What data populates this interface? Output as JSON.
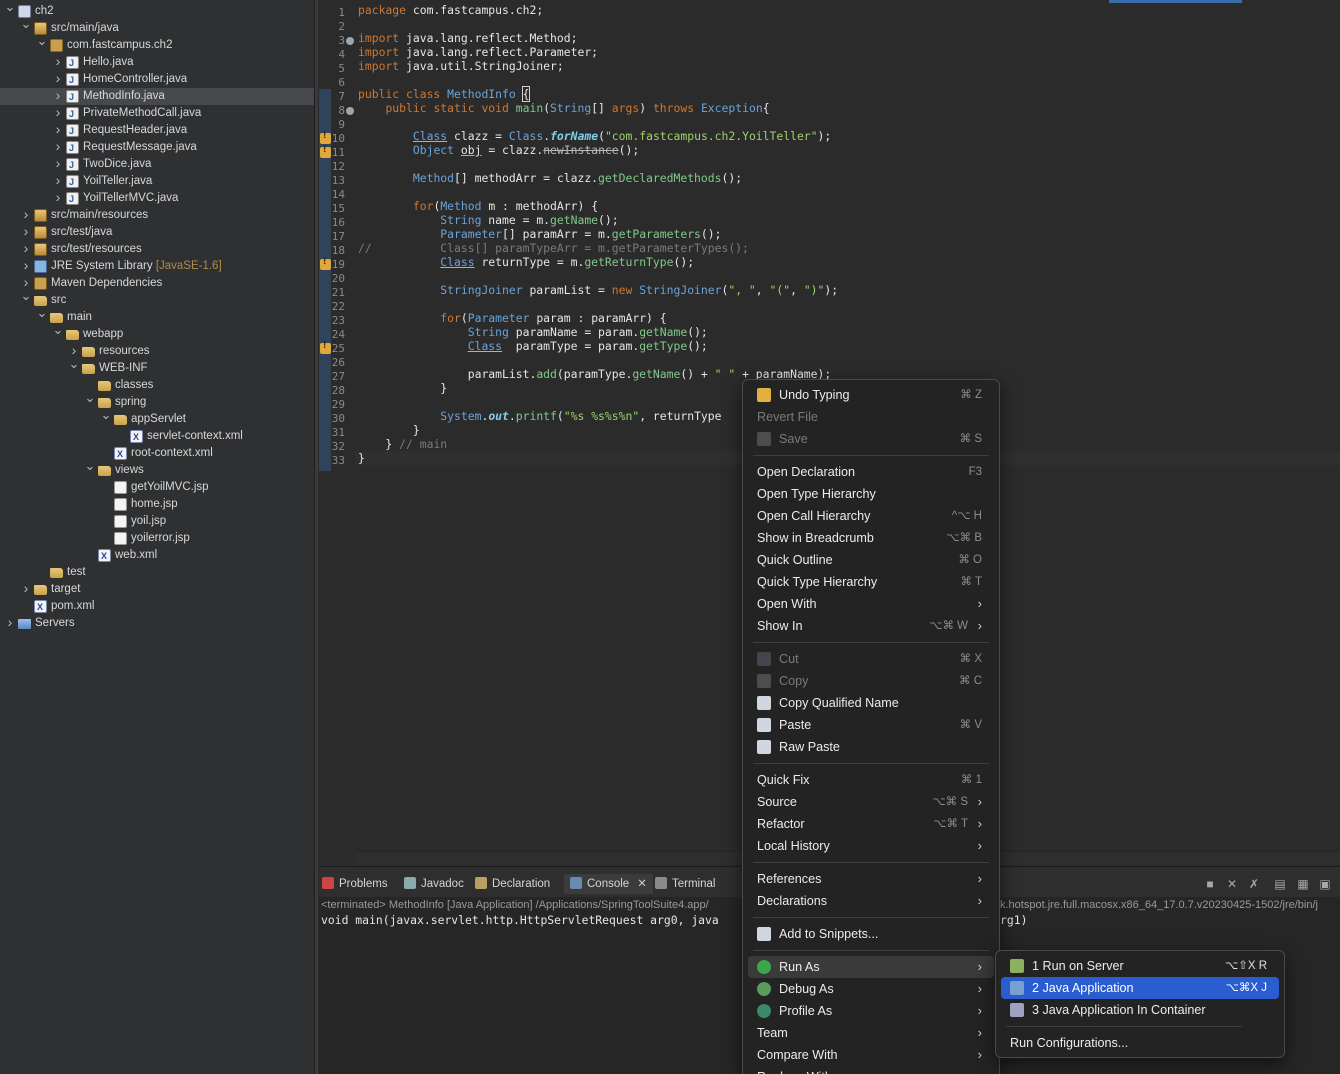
{
  "tree": {
    "items": [
      {
        "label": "ch2",
        "deco": "",
        "depth": 0,
        "twisty": "v",
        "icon": "project-icon",
        "ic": "proj",
        "selected": false
      },
      {
        "label": "src/main/java",
        "deco": "",
        "depth": 1,
        "twisty": "v",
        "icon": "source-folder-icon",
        "ic": "pkgroot",
        "selected": false
      },
      {
        "label": "com.fastcampus.ch2",
        "deco": "",
        "depth": 2,
        "twisty": "v",
        "icon": "package-icon",
        "ic": "pkg",
        "selected": false
      },
      {
        "label": "Hello.java",
        "deco": "",
        "depth": 3,
        "twisty": ">",
        "icon": "java-file-icon",
        "ic": "java",
        "selected": false
      },
      {
        "label": "HomeController.java",
        "deco": "",
        "depth": 3,
        "twisty": ">",
        "icon": "java-file-icon",
        "ic": "java",
        "selected": false
      },
      {
        "label": "MethodInfo.java",
        "deco": "",
        "depth": 3,
        "twisty": ">",
        "icon": "java-file-icon",
        "ic": "java",
        "selected": true
      },
      {
        "label": "PrivateMethodCall.java",
        "deco": "",
        "depth": 3,
        "twisty": ">",
        "icon": "java-file-icon",
        "ic": "java",
        "selected": false
      },
      {
        "label": "RequestHeader.java",
        "deco": "",
        "depth": 3,
        "twisty": ">",
        "icon": "java-file-icon",
        "ic": "java",
        "selected": false
      },
      {
        "label": "RequestMessage.java",
        "deco": "",
        "depth": 3,
        "twisty": ">",
        "icon": "java-file-icon",
        "ic": "java",
        "selected": false
      },
      {
        "label": "TwoDice.java",
        "deco": "",
        "depth": 3,
        "twisty": ">",
        "icon": "java-file-icon",
        "ic": "java",
        "selected": false
      },
      {
        "label": "YoilTeller.java",
        "deco": "",
        "depth": 3,
        "twisty": ">",
        "icon": "java-file-icon",
        "ic": "java",
        "selected": false
      },
      {
        "label": "YoilTellerMVC.java",
        "deco": "",
        "depth": 3,
        "twisty": ">",
        "icon": "java-file-icon",
        "ic": "java",
        "selected": false
      },
      {
        "label": "src/main/resources",
        "deco": "",
        "depth": 1,
        "twisty": ">",
        "icon": "source-folder-icon",
        "ic": "pkgroot",
        "selected": false
      },
      {
        "label": "src/test/java",
        "deco": "",
        "depth": 1,
        "twisty": ">",
        "icon": "source-folder-icon",
        "ic": "pkgroot",
        "selected": false
      },
      {
        "label": "src/test/resources",
        "deco": "",
        "depth": 1,
        "twisty": ">",
        "icon": "source-folder-icon",
        "ic": "pkgroot",
        "selected": false
      },
      {
        "label": "JRE System Library ",
        "deco": "[JavaSE-1.6]",
        "depth": 1,
        "twisty": ">",
        "icon": "library-icon",
        "ic": "lib",
        "selected": false
      },
      {
        "label": "Maven Dependencies",
        "deco": "",
        "depth": 1,
        "twisty": ">",
        "icon": "maven-library-icon",
        "ic": "mvn",
        "selected": false
      },
      {
        "label": "src",
        "deco": "",
        "depth": 1,
        "twisty": "v",
        "icon": "folder-icon",
        "ic": "folder",
        "selected": false
      },
      {
        "label": "main",
        "deco": "",
        "depth": 2,
        "twisty": "v",
        "icon": "folder-icon",
        "ic": "folder",
        "selected": false
      },
      {
        "label": "webapp",
        "deco": "",
        "depth": 3,
        "twisty": "v",
        "icon": "folder-icon",
        "ic": "folder",
        "selected": false
      },
      {
        "label": "resources",
        "deco": "",
        "depth": 4,
        "twisty": ">",
        "icon": "folder-icon",
        "ic": "folder",
        "selected": false
      },
      {
        "label": "WEB-INF",
        "deco": "",
        "depth": 4,
        "twisty": "v",
        "icon": "folder-icon",
        "ic": "folder",
        "selected": false
      },
      {
        "label": "classes",
        "deco": "",
        "depth": 5,
        "twisty": "",
        "icon": "folder-icon",
        "ic": "folder",
        "selected": false
      },
      {
        "label": "spring",
        "deco": "",
        "depth": 5,
        "twisty": "v",
        "icon": "folder-icon",
        "ic": "folder",
        "selected": false
      },
      {
        "label": "appServlet",
        "deco": "",
        "depth": 6,
        "twisty": "v",
        "icon": "folder-icon",
        "ic": "folder",
        "selected": false
      },
      {
        "label": "servlet-context.xml",
        "deco": "",
        "depth": 7,
        "twisty": "",
        "icon": "xml-file-icon",
        "ic": "xml",
        "selected": false
      },
      {
        "label": "root-context.xml",
        "deco": "",
        "depth": 6,
        "twisty": "",
        "icon": "xml-file-icon",
        "ic": "xml",
        "selected": false
      },
      {
        "label": "views",
        "deco": "",
        "depth": 5,
        "twisty": "v",
        "icon": "folder-icon",
        "ic": "folder",
        "selected": false
      },
      {
        "label": "getYoilMVC.jsp",
        "deco": "",
        "depth": 6,
        "twisty": "",
        "icon": "jsp-file-icon",
        "ic": "jsp",
        "selected": false
      },
      {
        "label": "home.jsp",
        "deco": "",
        "depth": 6,
        "twisty": "",
        "icon": "jsp-file-icon",
        "ic": "jsp",
        "selected": false
      },
      {
        "label": "yoil.jsp",
        "deco": "",
        "depth": 6,
        "twisty": "",
        "icon": "jsp-file-icon",
        "ic": "jsp",
        "selected": false
      },
      {
        "label": "yoilerror.jsp",
        "deco": "",
        "depth": 6,
        "twisty": "",
        "icon": "jsp-file-icon",
        "ic": "jsp",
        "selected": false
      },
      {
        "label": "web.xml",
        "deco": "",
        "depth": 5,
        "twisty": "",
        "icon": "xml-file-icon",
        "ic": "xml",
        "selected": false
      },
      {
        "label": "test",
        "deco": "",
        "depth": 2,
        "twisty": "",
        "icon": "folder-icon",
        "ic": "folder",
        "selected": false
      },
      {
        "label": "target",
        "deco": "",
        "depth": 1,
        "twisty": ">",
        "icon": "folder-icon",
        "ic": "folder",
        "selected": false
      },
      {
        "label": "pom.xml",
        "deco": "",
        "depth": 1,
        "twisty": "",
        "icon": "maven-pom-icon",
        "ic": "xml",
        "selected": false
      },
      {
        "label": "Servers",
        "deco": "",
        "depth": 0,
        "twisty": ">",
        "icon": "servers-folder-icon",
        "ic": "srv",
        "selected": false
      }
    ]
  },
  "editor": {
    "lines": [
      {
        "n": "1",
        "html": "<span class=\"k\">package</span> com.fastcampus.ch2;"
      },
      {
        "n": "2",
        "html": ""
      },
      {
        "n": "3",
        "html": "<span class=\"k\">import</span> java.lang.reflect.Method;",
        "fold": true
      },
      {
        "n": "4",
        "html": "<span class=\"k\">import</span> java.lang.reflect.Parameter;"
      },
      {
        "n": "5",
        "html": "<span class=\"k\">import</span> java.util.StringJoiner;"
      },
      {
        "n": "6",
        "html": ""
      },
      {
        "n": "7",
        "html": "<span class=\"k\">public class</span> <span class=\"ty\">MethodInfo</span> <span class=\"bracket\">{</span>"
      },
      {
        "n": "8",
        "html": "    <span class=\"k\">public static void</span> <span class=\"fn\">main</span>(<span class=\"ty\">String</span>[] <span class=\"k\">args</span>) <span class=\"k\">throws</span> <span class=\"ty\">Exception</span>{",
        "fold": true
      },
      {
        "n": "9",
        "html": ""
      },
      {
        "n": "10",
        "html": "        <span class=\"ty und\">Class</span> clazz = <span class=\"ty\">Class</span>.<span class=\"it\">forName</span>(<span class=\"st\">\"com.fastcampus.ch2.YoilTeller\"</span>);",
        "warn": true
      },
      {
        "n": "11",
        "html": "        <span class=\"ty\">Object</span> <span class=\"und\">obj</span> = clazz.<span class=\"strike\">newInstance</span>();",
        "warn": true
      },
      {
        "n": "12",
        "html": ""
      },
      {
        "n": "13",
        "html": "        <span class=\"ty\">Method</span>[] methodArr = clazz.<span class=\"fn\">getDeclaredMethods</span>();"
      },
      {
        "n": "14",
        "html": ""
      },
      {
        "n": "15",
        "html": "        <span class=\"k\">for</span>(<span class=\"ty\">Method</span> m : methodArr) {"
      },
      {
        "n": "16",
        "html": "            <span class=\"ty\">String</span> name = m.<span class=\"fn\">getName</span>();"
      },
      {
        "n": "17",
        "html": "            <span class=\"ty\">Parameter</span>[] paramArr = m.<span class=\"fn\">getParameters</span>();"
      },
      {
        "n": "18",
        "html": "<span class=\"cm\">//          Class[] paramTypeArr = m.getParameterTypes();</span>"
      },
      {
        "n": "19",
        "html": "            <span class=\"ty und\">Class</span> returnType = m.<span class=\"fn\">getReturnType</span>();",
        "warn": true
      },
      {
        "n": "20",
        "html": ""
      },
      {
        "n": "21",
        "html": "            <span class=\"ty\">StringJoiner</span> paramList = <span class=\"k\">new</span> <span class=\"ty\">StringJoiner</span>(<span class=\"st\">\", \"</span>, <span class=\"st\">\"(\"</span>, <span class=\"st\">\")\"</span>);"
      },
      {
        "n": "22",
        "html": ""
      },
      {
        "n": "23",
        "html": "            <span class=\"k\">for</span>(<span class=\"ty\">Parameter</span> param : paramArr) {"
      },
      {
        "n": "24",
        "html": "                <span class=\"ty\">String</span> paramName = param.<span class=\"fn\">getName</span>();"
      },
      {
        "n": "25",
        "html": "                <span class=\"ty und\">Class</span>  paramType = param.<span class=\"fn\">getType</span>();",
        "warn": true
      },
      {
        "n": "26",
        "html": ""
      },
      {
        "n": "27",
        "html": "                paramList.<span class=\"fn\">add</span>(paramType.<span class=\"fn\">getName</span>() + <span class=\"st\">\" \"</span> + paramName);"
      },
      {
        "n": "28",
        "html": "            }"
      },
      {
        "n": "29",
        "html": ""
      },
      {
        "n": "30",
        "html": "            <span class=\"ty\">System</span>.<span class=\"it\">out</span>.<span class=\"fn\">printf</span>(<span class=\"st\">\"%s %s%s%n\"</span>, returnType"
      },
      {
        "n": "31",
        "html": "        }"
      },
      {
        "n": "32",
        "html": "    } <span class=\"cm\">// main</span>"
      },
      {
        "n": "33",
        "html": "}",
        "current": true
      }
    ]
  },
  "console": {
    "tabs": [
      {
        "label": "Problems",
        "icon": "problems-icon",
        "active": false
      },
      {
        "label": "Javadoc",
        "icon": "javadoc-icon",
        "active": false
      },
      {
        "label": "Declaration",
        "icon": "declaration-icon",
        "active": false
      },
      {
        "label": "Console",
        "icon": "console-icon",
        "active": true
      },
      {
        "label": "Terminal",
        "icon": "terminal-icon",
        "active": false
      }
    ],
    "path_left": "<terminated> MethodInfo [Java Application] /Applications/SpringToolSuite4.app/",
    "path_right": "k.hotspot.jre.full.macosx.x86_64_17.0.7.v20230425-1502/jre/bin/j",
    "output_left": "void main(javax.servlet.http.HttpServletRequest arg0, java",
    "output_right": "rg1)"
  },
  "context_menu": {
    "items": [
      {
        "label": "Undo Typing",
        "shortcut": "⌘ Z",
        "icon": "undo-icon",
        "enabled": true,
        "submenu": false
      },
      {
        "label": "Revert File",
        "shortcut": "",
        "icon": "",
        "enabled": false,
        "submenu": false
      },
      {
        "label": "Save",
        "shortcut": "⌘ S",
        "icon": "save-icon",
        "enabled": false,
        "submenu": false
      },
      {
        "sep": true
      },
      {
        "label": "Open Declaration",
        "shortcut": "F3",
        "icon": "",
        "enabled": true,
        "submenu": false
      },
      {
        "label": "Open Type Hierarchy",
        "shortcut": "",
        "icon": "",
        "enabled": true,
        "submenu": false
      },
      {
        "label": "Open Call Hierarchy",
        "shortcut": "^⌥ H",
        "icon": "",
        "enabled": true,
        "submenu": false
      },
      {
        "label": "Show in Breadcrumb",
        "shortcut": "⌥⌘ B",
        "icon": "",
        "enabled": true,
        "submenu": false
      },
      {
        "label": "Quick Outline",
        "shortcut": "⌘ O",
        "icon": "",
        "enabled": true,
        "submenu": false
      },
      {
        "label": "Quick Type Hierarchy",
        "shortcut": "⌘ T",
        "icon": "",
        "enabled": true,
        "submenu": false
      },
      {
        "label": "Open With",
        "shortcut": "",
        "icon": "",
        "enabled": true,
        "submenu": true
      },
      {
        "label": "Show In",
        "shortcut": "⌥⌘ W",
        "icon": "",
        "enabled": true,
        "submenu": true
      },
      {
        "sep": true
      },
      {
        "label": "Cut",
        "shortcut": "⌘ X",
        "icon": "cut-icon",
        "enabled": false,
        "submenu": false
      },
      {
        "label": "Copy",
        "shortcut": "⌘ C",
        "icon": "copy-icon",
        "enabled": false,
        "submenu": false
      },
      {
        "label": "Copy Qualified Name",
        "shortcut": "",
        "icon": "copy-qualified-name-icon",
        "enabled": true,
        "submenu": false
      },
      {
        "label": "Paste",
        "shortcut": "⌘ V",
        "icon": "paste-icon",
        "enabled": true,
        "submenu": false
      },
      {
        "label": "Raw Paste",
        "shortcut": "",
        "icon": "raw-paste-icon",
        "enabled": true,
        "submenu": false
      },
      {
        "sep": true
      },
      {
        "label": "Quick Fix",
        "shortcut": "⌘ 1",
        "icon": "",
        "enabled": true,
        "submenu": false
      },
      {
        "label": "Source",
        "shortcut": "⌥⌘ S",
        "icon": "",
        "enabled": true,
        "submenu": true
      },
      {
        "label": "Refactor",
        "shortcut": "⌥⌘ T",
        "icon": "",
        "enabled": true,
        "submenu": true
      },
      {
        "label": "Local History",
        "shortcut": "",
        "icon": "",
        "enabled": true,
        "submenu": true
      },
      {
        "sep": true
      },
      {
        "label": "References",
        "shortcut": "",
        "icon": "",
        "enabled": true,
        "submenu": true
      },
      {
        "label": "Declarations",
        "shortcut": "",
        "icon": "",
        "enabled": true,
        "submenu": true
      },
      {
        "sep": true
      },
      {
        "label": "Add to Snippets...",
        "shortcut": "",
        "icon": "snippets-icon",
        "enabled": true,
        "submenu": false
      },
      {
        "sep": true
      },
      {
        "label": "Run As",
        "shortcut": "",
        "icon": "run-icon",
        "enabled": true,
        "submenu": true,
        "highlight": true
      },
      {
        "label": "Debug As",
        "shortcut": "",
        "icon": "debug-icon",
        "enabled": true,
        "submenu": true
      },
      {
        "label": "Profile As",
        "shortcut": "",
        "icon": "profile-icon",
        "enabled": true,
        "submenu": true
      },
      {
        "label": "Team",
        "shortcut": "",
        "icon": "",
        "enabled": true,
        "submenu": true
      },
      {
        "label": "Compare With",
        "shortcut": "",
        "icon": "",
        "enabled": true,
        "submenu": true
      },
      {
        "label": "Replace With",
        "shortcut": "",
        "icon": "",
        "enabled": true,
        "submenu": true
      }
    ]
  },
  "run_as_submenu": {
    "items": [
      {
        "label": "1 Run on Server",
        "shortcut": "⌥⇧X R",
        "icon": "run-on-server-icon",
        "selected": false
      },
      {
        "label": "2 Java Application",
        "shortcut": "⌥⌘X J",
        "icon": "java-application-icon",
        "selected": true
      },
      {
        "label": "3 Java Application In Container",
        "shortcut": "",
        "icon": "java-container-icon",
        "selected": false
      },
      {
        "sep": true
      },
      {
        "label": "Run Configurations...",
        "shortcut": "",
        "icon": "",
        "selected": false
      }
    ]
  }
}
